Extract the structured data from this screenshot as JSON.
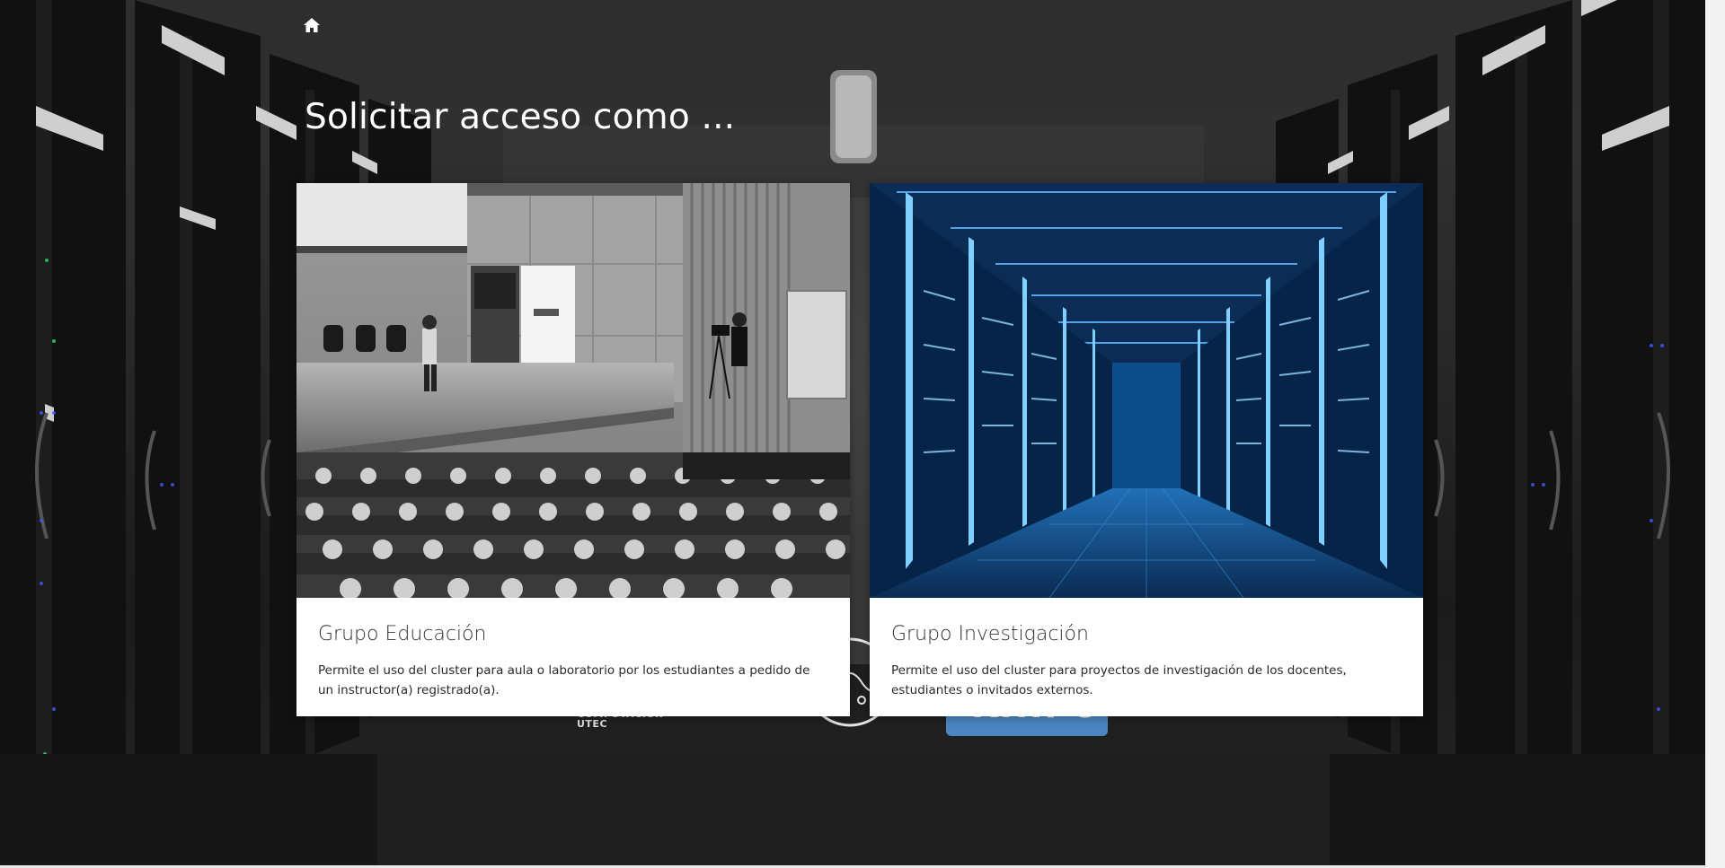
{
  "header": {
    "home_icon": "home-icon"
  },
  "page": {
    "title": "Solicitar acceso como ..."
  },
  "cards": [
    {
      "title": "Grupo Educación",
      "description": "Permite el uso del cluster para aula o laboratorio por los estudiantes a pedido de un instructor(a) registrado(a).",
      "image": "auditorium-photo"
    },
    {
      "title": "Grupo Investigación",
      "description": "Permite el uso del cluster para proyectos de investigación de los docentes, estudiantes o invitados externos.",
      "image": "datacenter-photo"
    }
  ],
  "footer_logos": {
    "computacion_text": "COMPUTACIÓN\nUTEC",
    "khipu_text": "KHIPU",
    "accent_blue": "#4b87c3"
  },
  "colors": {
    "title": "#ffffff",
    "card_background": "#ffffff",
    "card_title": "#333333",
    "card_text": "#2a2a2a"
  }
}
